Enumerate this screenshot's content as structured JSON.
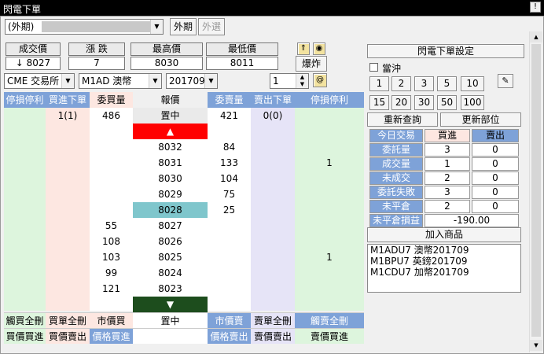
{
  "window": {
    "title": "閃電下單",
    "corner_btn": "!"
  },
  "top": {
    "account_prefix": "(外期)",
    "btn_external": "外期",
    "btn_select": "外選"
  },
  "stats": [
    {
      "label": "成交價",
      "value": "↓ 8027"
    },
    {
      "label": "漲 跌",
      "value": "7"
    },
    {
      "label": "最高價",
      "value": "8030"
    },
    {
      "label": "最低價",
      "value": "8011"
    }
  ],
  "explode_btn": "爆炸",
  "selectors": {
    "exchange": "CME 交易所",
    "product": "M1AD  澳幣",
    "month": "201709",
    "qty": "1"
  },
  "grid": {
    "headers": [
      "停損停利",
      "買進下單",
      "委買量",
      "報價",
      "委賣量",
      "賣出下單",
      "停損停利"
    ],
    "row0": {
      "buy_order": "1(1)",
      "bid_qty": "486",
      "center": "置中",
      "ask_qty": "421",
      "sell_order": "0(0)"
    },
    "up_arrow": "▲",
    "down_arrow": "▼",
    "rows": [
      {
        "price": "8032",
        "bid": "",
        "ask": "84",
        "right": ""
      },
      {
        "price": "8031",
        "bid": "",
        "ask": "133",
        "right": "1"
      },
      {
        "price": "8030",
        "bid": "",
        "ask": "104",
        "right": ""
      },
      {
        "price": "8029",
        "bid": "",
        "ask": "75",
        "right": ""
      },
      {
        "price": "8028",
        "bid": "",
        "ask": "25",
        "right": ""
      },
      {
        "price": "8027",
        "bid": "55",
        "ask": "",
        "right": ""
      },
      {
        "price": "8026",
        "bid": "108",
        "ask": "",
        "right": ""
      },
      {
        "price": "8025",
        "bid": "103",
        "ask": "",
        "right": "1"
      },
      {
        "price": "8024",
        "bid": "99",
        "ask": "",
        "right": ""
      },
      {
        "price": "8023",
        "bid": "121",
        "ask": "",
        "right": ""
      }
    ],
    "footer1": [
      "觸買全刪",
      "買單全刪",
      "市價買",
      "置中",
      "市價賣",
      "賣單全刪",
      "觸賣全刪"
    ],
    "footer2": [
      "買價買進",
      "買價賣出",
      "價格買進",
      "",
      "價格賣出",
      "賣價賣出",
      "賣價買進"
    ]
  },
  "right": {
    "settings_btn": "閃電下單設定",
    "hedge_label": "當沖",
    "qty_row1": [
      "1",
      "2",
      "3",
      "5",
      "10"
    ],
    "qty_row2": [
      "15",
      "20",
      "30",
      "50",
      "100"
    ],
    "requery_btn": "重新查詢",
    "refresh_btn": "更新部位",
    "table_head": [
      "今日交易",
      "買進",
      "賣出"
    ],
    "table_rows": [
      {
        "label": "委託量",
        "buy": "3",
        "sell": "0"
      },
      {
        "label": "成交量",
        "buy": "1",
        "sell": "0"
      },
      {
        "label": "未成交",
        "buy": "2",
        "sell": "0"
      },
      {
        "label": "委託失敗",
        "buy": "3",
        "sell": "0"
      },
      {
        "label": "未平倉",
        "buy": "2",
        "sell": "0"
      }
    ],
    "pnl_label": "未平倉損益",
    "pnl_value": "-190.00",
    "add_btn": "加入商品",
    "products": [
      "M1ADU7 澳幣201709",
      "M1BPU7 英鎊201709",
      "M1CDU7 加幣201709"
    ]
  },
  "colors": {
    "stop_bg": "#ddf5dd",
    "buy_bg": "#fde7e1",
    "sell_bg": "#e6e4f7",
    "header_blue": "#7ea2d8",
    "up_red": "#ff0000",
    "down_green": "#1d4d1d",
    "last_price_bg": "#7fc6cc"
  }
}
